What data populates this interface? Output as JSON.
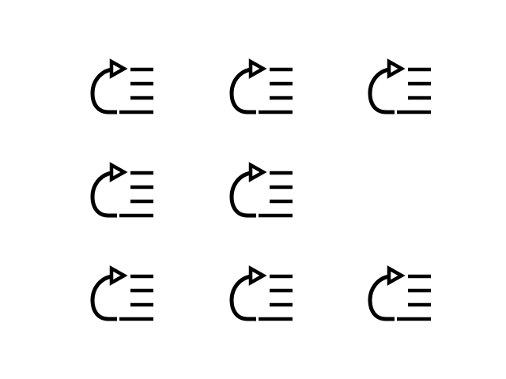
{
  "icon_grid": {
    "icon": "redo-list-icon",
    "color": "#000000",
    "background": "#ffffff",
    "rows": [
      [
        "redo-list-icon",
        "redo-list-icon",
        "redo-list-icon"
      ],
      [
        "redo-list-icon",
        "redo-list-icon",
        null
      ],
      [
        "redo-list-icon",
        "redo-list-icon",
        "redo-list-icon"
      ]
    ]
  }
}
